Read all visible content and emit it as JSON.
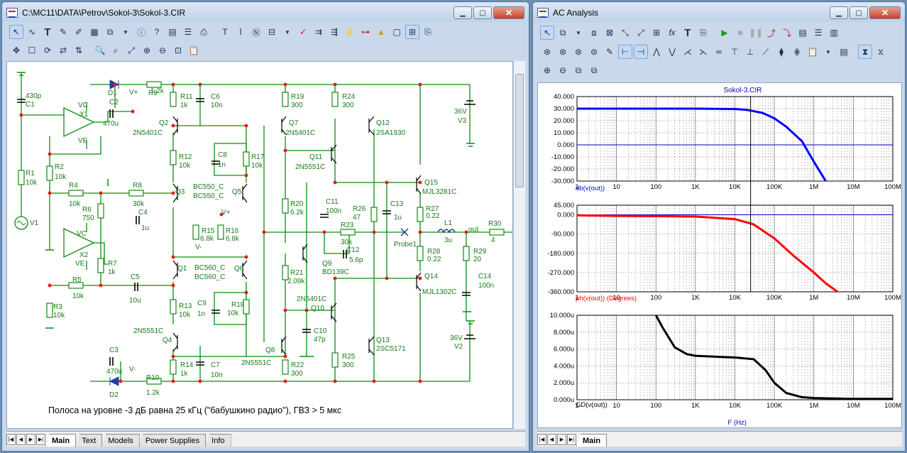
{
  "schematic_window": {
    "title": "C:\\MC11\\DATA\\Petrov\\Sokol-3\\Sokol-3.CIR",
    "caption": "Полоса на уровне -3 дБ равна 25 кГц (\"бабушкино радио\"), ГВЗ > 5 мкс",
    "tabs": [
      "Main",
      "Text",
      "Models",
      "Power Supplies",
      "Info"
    ],
    "labels": {
      "c1": "C1",
      "c1v": "430p",
      "d1": "D1",
      "c2": "C2",
      "r9": "R9",
      "r9v": "1.2k",
      "vplus1": "V+",
      "x1": "X1",
      "vc": "VC",
      "ve": "VE",
      "c2v": "470u",
      "r11": "R11",
      "r11v": "1k",
      "c6": "C6",
      "c6v": "10n",
      "q2": "Q2",
      "q2m": "2N5401C",
      "q7": "Q7",
      "q7m": "2N5401C",
      "r19": "R19",
      "r19v": "300",
      "r24": "R24",
      "r24v": "300",
      "q12": "Q12",
      "q12m": "2SA1930",
      "v3": "V3",
      "v3v": "36V",
      "r2": "R2",
      "r2v": "10k",
      "r1": "R1",
      "r1v": "10k",
      "c8": "C8",
      "c8v": "1n",
      "r17": "R17",
      "r17v": "10k",
      "r12": "R12",
      "r12v": "10k",
      "q11": "Q11",
      "q11m": "2N5551C",
      "r4": "R4",
      "r4v": "10k",
      "r8": "R8",
      "r8v": "30k",
      "q3": "Q3",
      "q3m": "BC550_C",
      "q5": "Q5",
      "q5m": "BC550_C",
      "q15": "Q15",
      "q15m": "MJL3281C",
      "r6": "R6",
      "r6v": "750",
      "c4": "C4",
      "c4v": "1u",
      "r20": "R20",
      "r20v": "6.2k",
      "c11": "C11",
      "c11v": "100n",
      "r26": "R26",
      "r26v": "47",
      "c13": "C13",
      "c13v": "1u",
      "r27": "R27",
      "r27v": "0.22",
      "v1": "V1",
      "r15": "R15",
      "r15v": "6.8k",
      "r16": "R16",
      "r16v": "6.8k",
      "vminus": "V-",
      "x2": "X2",
      "r23": "R23",
      "r23v": "30k",
      "c12": "C12",
      "c12v": "5.6p",
      "probe1": "Probe1",
      "l1": "L1",
      "l1v": "3u",
      "out": "out",
      "r30": "R30",
      "r30v": "4",
      "r7": "R7",
      "r7v": "1k",
      "q1": "Q1",
      "q1m": "BC560_C",
      "q6": "Q6",
      "q6m": "BC560_C",
      "q9": "Q9",
      "q9m": "BD139C",
      "r21": "R21",
      "r21v": "2.09k",
      "r28": "R28",
      "r28v": "0.22",
      "r29": "R29",
      "r29v": "20",
      "q14": "Q14",
      "q14m": "MJL1302C",
      "c14": "C14",
      "c14v": "100n",
      "r5": "R5",
      "r5v": "10k",
      "c5": "C5",
      "c5v": "10u",
      "r3": "R3",
      "r3v": "10k",
      "r13": "R13",
      "r13v": "10k",
      "c9": "C9",
      "c9v": "1n",
      "r18": "R18",
      "r18v": "10k",
      "q10": "Q10",
      "q10m": "2N5401C",
      "c10": "C10",
      "c10v": "47p",
      "q4": "Q4",
      "q4m": "2N5551C",
      "q13": "Q13",
      "q13m": "2SC5171",
      "v2": "V2",
      "v2v": "36V",
      "q8": "Q8",
      "q8m": "2N5551C",
      "r25": "R25",
      "r25v": "300",
      "c3": "C3",
      "c3v": "470u",
      "r14": "R14",
      "r14v": "1k",
      "c7": "C7",
      "c7v": "10n",
      "r22": "R22",
      "r22v": "300",
      "vminus2": "V-",
      "r10": "R10",
      "r10v": "1.2k",
      "d2": "D2"
    }
  },
  "analysis_window": {
    "title": "AC Analysis",
    "plot_title": "Sokol-3.CIR",
    "tabs": [
      "Main"
    ],
    "x_axis_label": "F (Hz)",
    "x_ticks": [
      "1",
      "10",
      "100",
      "1K",
      "10K",
      "100K",
      "1M",
      "10M",
      "100M"
    ],
    "colors": {
      "db": "#0000ff",
      "ph": "#ff0000",
      "gd": "#000000"
    }
  },
  "chart_data": [
    {
      "type": "line",
      "title": "Sokol-3.CIR",
      "xlabel": "F (Hz)",
      "ylabel": "db(v(out))",
      "x_scale": "log",
      "xlim": [
        1,
        100000000
      ],
      "ylim": [
        -30,
        40
      ],
      "y_ticks": [
        "40.000",
        "30.000",
        "20.000",
        "10.000",
        "0.000",
        "-10.000",
        "-20.000",
        "-30.000"
      ],
      "series": [
        {
          "name": "db(v(out))",
          "color": "#0000ff",
          "x": [
            1,
            10,
            100,
            1000,
            10000,
            20000,
            50000,
            100000,
            200000,
            500000,
            1000000,
            2000000
          ],
          "y": [
            30,
            30,
            30,
            30,
            29.7,
            29,
            26.5,
            22,
            15,
            3,
            -14,
            -30
          ]
        }
      ]
    },
    {
      "type": "line",
      "ylabel": "ph(v(out)) (Degrees)",
      "x_scale": "log",
      "xlim": [
        1,
        100000000
      ],
      "ylim": [
        -360,
        45
      ],
      "y_ticks": [
        "45.000",
        "0.000",
        "-90.000",
        "-180.000",
        "-270.000",
        "-360.000"
      ],
      "series": [
        {
          "name": "ph(v(out)) (Degrees)",
          "color": "#ff0000",
          "x": [
            1,
            10,
            100,
            1000,
            10000,
            30000,
            100000,
            300000,
            1000000,
            2000000,
            4000000
          ],
          "y": [
            -2,
            -5,
            -6,
            -8,
            -20,
            -45,
            -110,
            -190,
            -270,
            -320,
            -360
          ]
        }
      ]
    },
    {
      "type": "line",
      "ylabel": "GD(v(out))",
      "x_scale": "log",
      "xlim": [
        1,
        100000000
      ],
      "ylim": [
        0,
        10
      ],
      "y_ticks": [
        "10.000u",
        "8.000u",
        "6.000u",
        "4.000u",
        "2.000u",
        "0.000u"
      ],
      "series": [
        {
          "name": "GD(v(out))",
          "color": "#000000",
          "x": [
            100,
            150,
            300,
            600,
            1000,
            3000,
            10000,
            30000,
            60000,
            100000,
            200000,
            500000,
            1000000,
            10000000,
            100000000
          ],
          "y": [
            10,
            8.5,
            6.2,
            5.4,
            5.2,
            5.1,
            5.0,
            4.8,
            3.5,
            2.0,
            0.8,
            0.3,
            0.2,
            0.1,
            0.1
          ]
        }
      ]
    }
  ]
}
